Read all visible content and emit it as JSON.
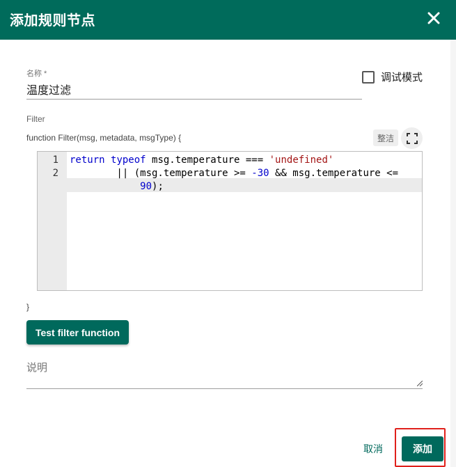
{
  "dialog": {
    "title": "添加规则节点",
    "close_icon": "close-icon"
  },
  "form": {
    "name_label": "名称 *",
    "name_value": "温度过滤",
    "debug_label": "调试模式",
    "debug_checked": false,
    "filter_label": "Filter",
    "function_signature": "function Filter(msg, metadata, msgType) {",
    "tidy_label": "整洁",
    "fullscreen_icon": "fullscreen-icon",
    "closing_brace": "}",
    "test_button_label": "Test filter function",
    "description_label": "说明"
  },
  "editor": {
    "line_numbers": [
      "1",
      "2"
    ],
    "lines": [
      "return typeof msg.temperature === 'undefined'",
      "        || (msg.temperature >= -30 && msg.temperature <=",
      "            90);"
    ]
  },
  "actions": {
    "cancel_label": "取消",
    "add_label": "添加"
  },
  "colors": {
    "primary": "#006b5b",
    "highlight": "#e0201b"
  }
}
